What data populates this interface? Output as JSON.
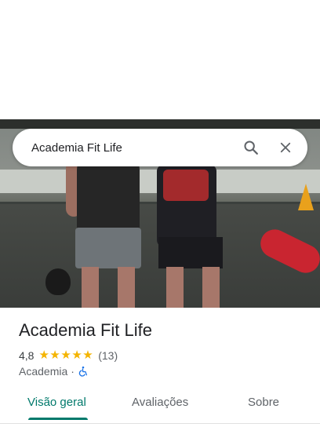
{
  "search": {
    "value": "Academia Fit Life"
  },
  "place": {
    "name": "Academia Fit Life",
    "rating": "4,8",
    "stars": 5,
    "review_count": "(13)",
    "category": "Academia",
    "separator": "·",
    "accessibility_icon": "wheelchair-icon"
  },
  "tabs": [
    {
      "label": "Visão geral",
      "selected": true
    },
    {
      "label": "Avaliações",
      "selected": false
    },
    {
      "label": "Sobre",
      "selected": false
    }
  ],
  "colors": {
    "accent": "#00796b",
    "star": "#f4b400",
    "accessibility": "#1a73e8",
    "text_primary": "#202124",
    "text_secondary": "#5f6368"
  }
}
